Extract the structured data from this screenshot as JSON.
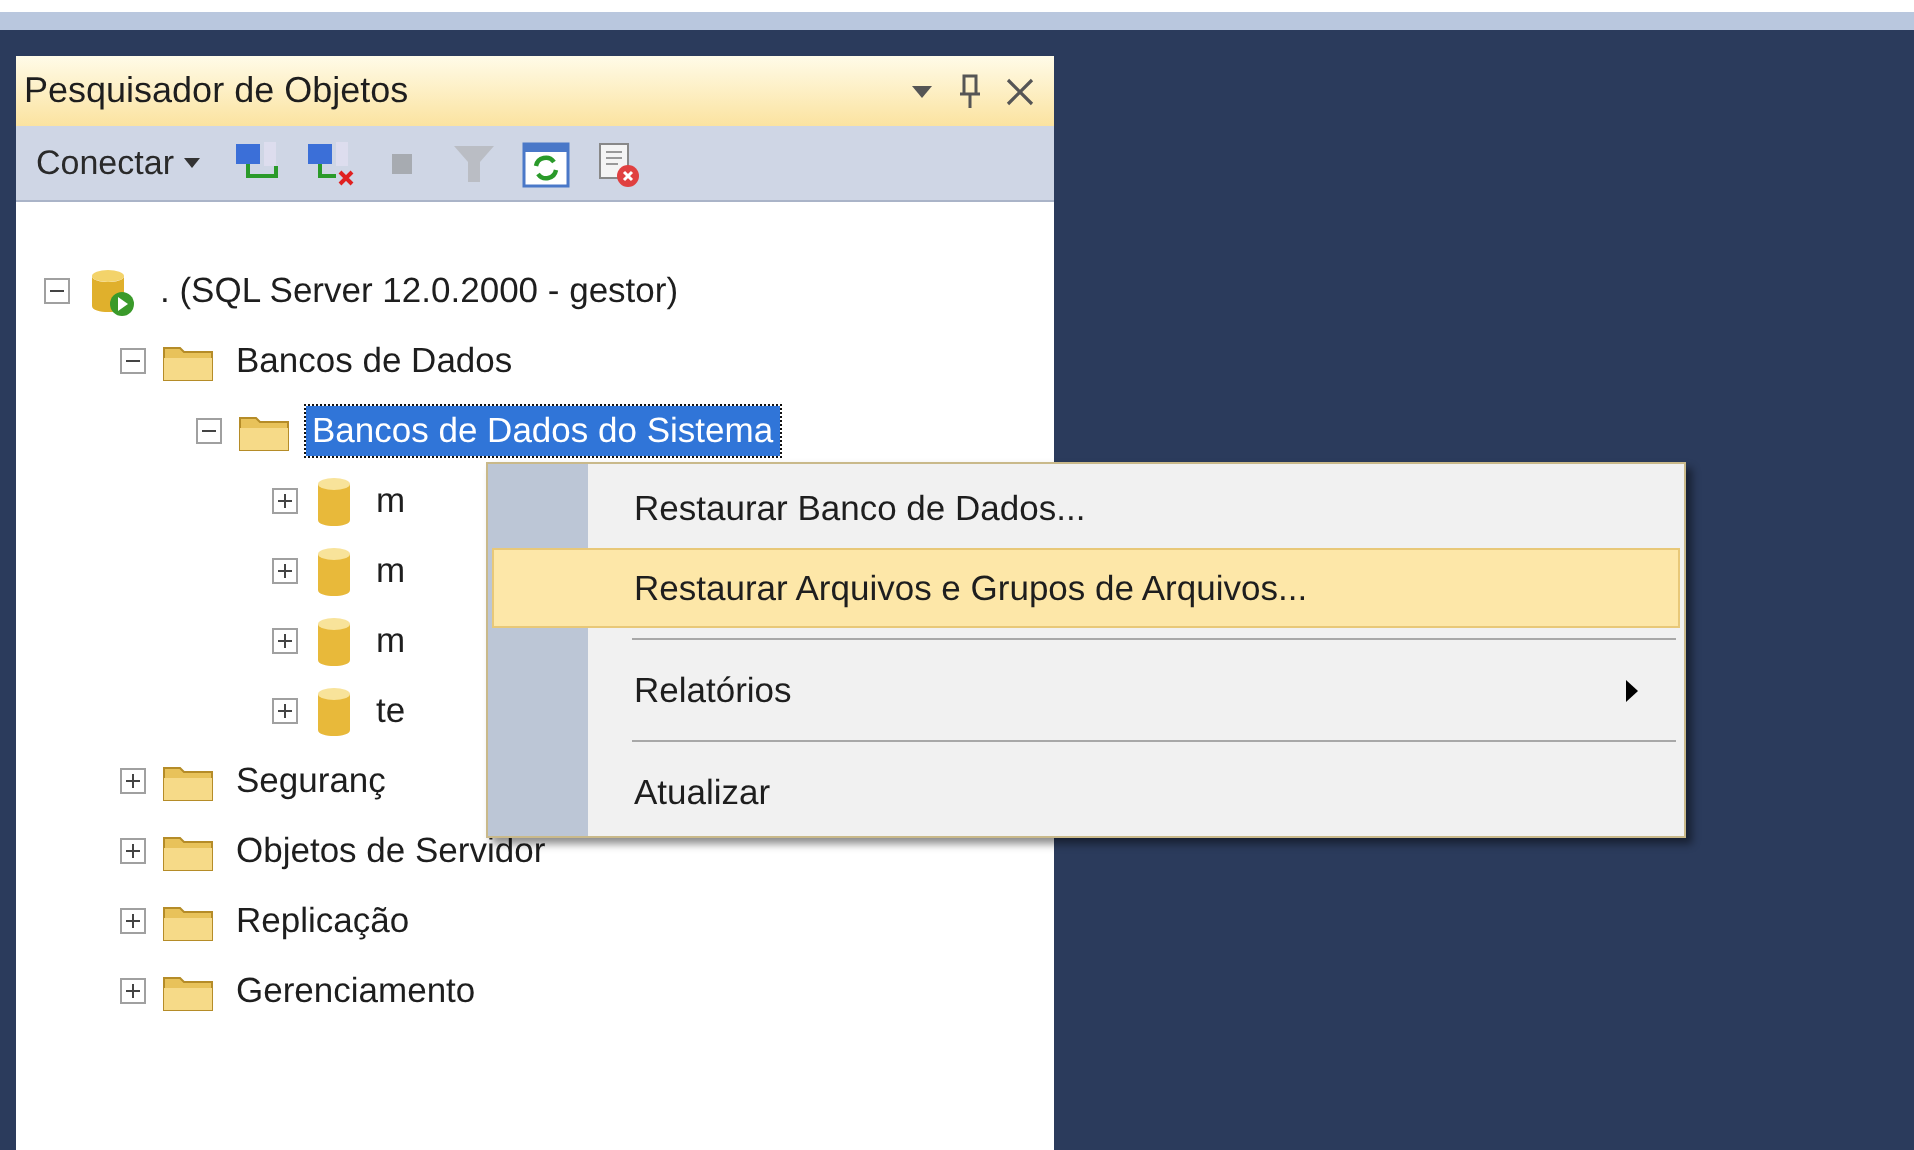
{
  "panel": {
    "title": "Pesquisador de Objetos",
    "toolbar": {
      "connect_label": "Conectar",
      "tools": [
        {
          "kind": "connect",
          "disabled": false
        },
        {
          "kind": "disconnect",
          "disabled": false
        },
        {
          "kind": "stop",
          "disabled": true
        },
        {
          "kind": "filter",
          "disabled": true
        },
        {
          "kind": "refresh",
          "disabled": false
        },
        {
          "kind": "script",
          "disabled": false
        }
      ]
    }
  },
  "tree": [
    {
      "label": ". (SQL Server 12.0.2000 - gestor)",
      "kind": "server",
      "expanded": true,
      "selected": false,
      "children": [
        {
          "label": "Bancos de Dados",
          "kind": "folder",
          "expanded": true,
          "selected": false,
          "children": [
            {
              "label": "Bancos de Dados do Sistema",
              "kind": "folder",
              "expanded": true,
              "selected": true,
              "children": [
                {
                  "label": "m",
                  "kind": "database",
                  "expanded": false,
                  "selected": false
                },
                {
                  "label": "m",
                  "kind": "database",
                  "expanded": false,
                  "selected": false
                },
                {
                  "label": "m",
                  "kind": "database",
                  "expanded": false,
                  "selected": false
                },
                {
                  "label": "te",
                  "kind": "database",
                  "expanded": false,
                  "selected": false
                }
              ]
            }
          ]
        },
        {
          "label": "Seguranç",
          "kind": "folder",
          "expanded": false,
          "selected": false
        },
        {
          "label": "Objetos de Servidor",
          "kind": "folder",
          "expanded": false,
          "selected": false
        },
        {
          "label": "Replicação",
          "kind": "folder",
          "expanded": false,
          "selected": false
        },
        {
          "label": "Gerenciamento",
          "kind": "folder",
          "expanded": false,
          "selected": false
        }
      ]
    }
  ],
  "context_menu": [
    {
      "kind": "item",
      "label": "Restaurar Banco de Dados...",
      "selected": false,
      "submenu": false
    },
    {
      "kind": "item",
      "label": "Restaurar Arquivos e Grupos de Arquivos...",
      "selected": true,
      "submenu": false
    },
    {
      "kind": "separator"
    },
    {
      "kind": "item",
      "label": "Relatórios",
      "selected": false,
      "submenu": true
    },
    {
      "kind": "separator"
    },
    {
      "kind": "item",
      "label": "Atualizar",
      "selected": false,
      "submenu": false
    }
  ]
}
